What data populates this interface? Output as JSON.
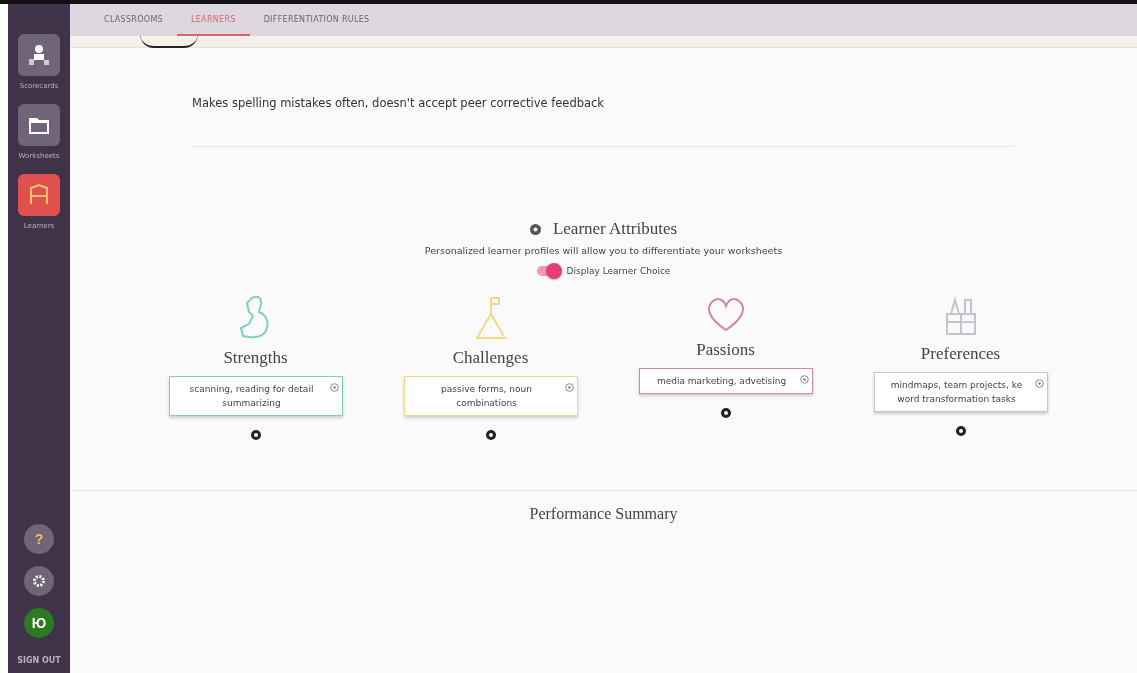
{
  "sidebar": {
    "items": [
      {
        "label": "Scorecards",
        "selected": false,
        "kind": "scorecards"
      },
      {
        "label": "Worksheets",
        "selected": false,
        "kind": "worksheets"
      },
      {
        "label": "Learners",
        "selected": true,
        "kind": "learners"
      }
    ],
    "help": "?",
    "avatar": "Ю",
    "sign_out": "SIGN OUT"
  },
  "tabs": [
    {
      "label": "CLASSROOMS",
      "selected": false
    },
    {
      "label": "LEARNERS",
      "selected": true
    },
    {
      "label": "DIFFERENTIATION RULES",
      "selected": false
    }
  ],
  "note": "Makes spelling mistakes often, doesn't accept peer corrective feedback",
  "attributes": {
    "title": "Learner Attributes",
    "subtitle": "Personalized learner profiles will allow you to differentiate your worksheets",
    "toggle": {
      "label": "Display Learner Choice",
      "on": true
    },
    "columns": [
      {
        "kind": "strengths",
        "title": "Strengths",
        "color": "#7fcfc4",
        "lines": [
          "scanning, reading for detail",
          "summarizing"
        ]
      },
      {
        "kind": "challenges",
        "title": "Challenges",
        "color": "#f2d98a",
        "lines": [
          "passive forms, noun",
          "combinations"
        ]
      },
      {
        "kind": "passions",
        "title": "Passions",
        "color": "#d48a9a",
        "lines": [
          "media marketing, advetising"
        ]
      },
      {
        "kind": "preferences",
        "title": "Preferences",
        "color": "#c9c2cc",
        "lines": [
          "mindmaps, team projects, ke",
          "word transformation tasks"
        ]
      }
    ]
  },
  "performance": {
    "title": "Performance Summary"
  }
}
